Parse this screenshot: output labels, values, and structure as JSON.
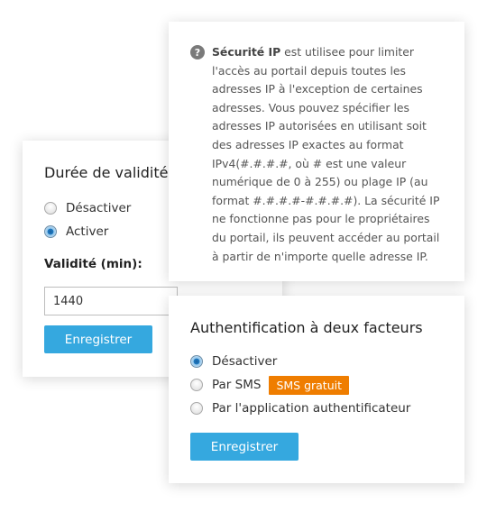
{
  "validity_card": {
    "title": "Durée de validité de la session",
    "options": [
      {
        "label": "Désactiver",
        "selected": false
      },
      {
        "label": "Activer",
        "selected": true
      }
    ],
    "field_label": "Validité (min):",
    "field_value": "1440",
    "save_label": "Enregistrer"
  },
  "info_card": {
    "icon": "help-icon",
    "bold_term": "Sécurité IP",
    "text": " est utilisee pour limiter l'accès au portail depuis toutes les adresses IP à l'exception de certaines adresses. Vous pouvez spécifier les adresses IP autorisées en utilisant soit des adresses IP exactes au format IPv4(#.#.#.#, où # est une valeur numérique de 0 à 255) ou plage IP (au format #.#.#.#-#.#.#.#). La sécurité IP ne fonctionne pas pour le propriétaires du portail, ils peuvent accéder au portail à partir de n'importe quelle adresse IP."
  },
  "tfa_card": {
    "title": "Authentification à deux facteurs",
    "options": [
      {
        "label": "Désactiver",
        "selected": true
      },
      {
        "label": "Par SMS",
        "selected": false
      },
      {
        "label": "Par l'application authentificateur",
        "selected": false
      }
    ],
    "sms_badge": "SMS gratuit",
    "save_label": "Enregistrer"
  },
  "colors": {
    "accent_button": "#35a8df",
    "badge": "#ef7d00"
  }
}
